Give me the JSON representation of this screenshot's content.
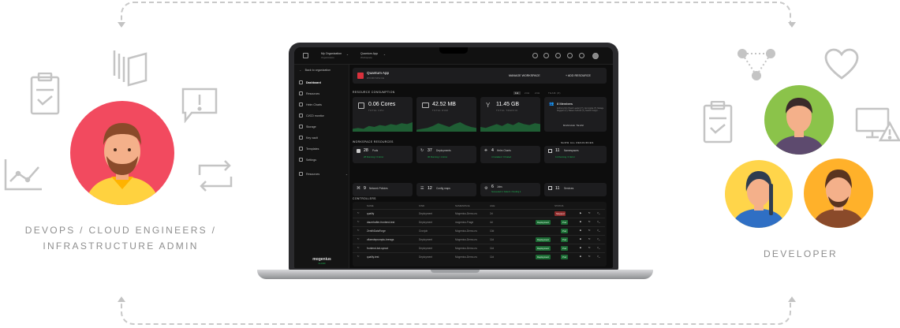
{
  "roles": {
    "ops_line1": "DEVOPS / CLOUD ENGINEERS /",
    "ops_line2": "INFRASTRUCTURE ADMIN",
    "dev": "DEVELOPER"
  },
  "colors": {
    "icon_gray": "#c4c4c4",
    "ops_avatar_bg": "#f24a5f",
    "dev_avatar_bg_1": "#8bc34a",
    "dev_avatar_bg_2": "#ffd54a",
    "dev_avatar_bg_3": "#ffb12a",
    "accent_green": "#1db954",
    "brand_red": "#d9313c"
  },
  "side_icons_left": [
    "clipboard-check-icon",
    "stacked-cards-icon",
    "alert-message-icon",
    "line-chart-icon",
    "sync-arrows-icon"
  ],
  "side_icons_right": [
    "network-nodes-icon",
    "heart-icon",
    "clipboard-check-icon",
    "monitor-warning-icon"
  ],
  "app": {
    "org_label": "My Organization",
    "org_sub": "Organization",
    "project_label": "Quantum App",
    "project_sub": "Workspace",
    "back_link": "Back to organization",
    "sidebar": [
      {
        "label": "Dashboard",
        "active": true
      },
      {
        "label": "Resources"
      },
      {
        "label": "Helm Charts"
      },
      {
        "label": "CI/CD monitor"
      },
      {
        "label": "Storage"
      },
      {
        "label": "Key vault"
      },
      {
        "label": "Templates"
      },
      {
        "label": "Settings"
      },
      {
        "label": "Resources"
      }
    ],
    "brand": "mogenius",
    "brand_sub": "CLOUD",
    "workspace_title": "Quantum App",
    "workspace_sub": "WORKSPACE",
    "manage_btn": "MANAGE WORKSPACE",
    "add_btn": "+ ADD RESOURCE",
    "consumption_title": "RESOURCE CONSUMPTION",
    "time_tabs": [
      "1H",
      "24H",
      "24H",
      "TEAM (8)"
    ],
    "metrics": [
      {
        "value": "0.06 Cores",
        "label": "TOTAL CPU",
        "series": [
          3,
          4,
          3,
          6,
          5,
          7,
          6,
          8,
          7,
          9,
          8,
          10
        ]
      },
      {
        "value": "42.52 MB",
        "label": "TOTAL RAM",
        "series": [
          2,
          3,
          4,
          6,
          9,
          7,
          5,
          8,
          10,
          7,
          5,
          4
        ]
      },
      {
        "value": "11.45 GB",
        "label": "TOTAL TRAFFIC",
        "series": [
          5,
          4,
          6,
          8,
          6,
          9,
          7,
          10,
          8,
          7,
          9,
          8
        ]
      }
    ],
    "team": {
      "title": "8 Members",
      "text": "Anthony Kim (Team Leader) (T), Jan Lippke (T), Melage Ruggiero (T), Maisen Schmitt (T), Nesbitt Yeeger ...",
      "button": "MANAGE TEAM"
    },
    "workspace_resources_title": "WORKSPACE RESOURCES",
    "show_all": "SHOW ALL RESOURCES",
    "resource_cards": [
      {
        "count": "28",
        "name": "Pods",
        "detail": "28 Running / 0 Error"
      },
      {
        "count": "37",
        "name": "Deployments",
        "detail": "36 Running / 1 Error"
      },
      {
        "count": "4",
        "name": "Helm Charts",
        "detail": "4 Installed / 0 Failed"
      },
      {
        "count": "11",
        "name": "Namespaces",
        "detail": "11 Running / 0 Error"
      }
    ],
    "resource_cards_row2": [
      {
        "count": "9",
        "name": "Network Policies",
        "detail": ""
      },
      {
        "count": "12",
        "name": "Config maps",
        "detail": ""
      },
      {
        "count": "6",
        "name": "Jobs",
        "detail": "Succeeded 3 / Failed 1 / Pending 2"
      },
      {
        "count": "11",
        "name": "Services",
        "detail": ""
      }
    ],
    "controllers_title": "CONTROLLERS",
    "controllers_cols": [
      "NAME",
      "KIND",
      "NAMESPACE",
      "AGE",
      "STATUS"
    ],
    "controllers_rows": [
      {
        "name": "quality",
        "kind": "Deployment",
        "ns": "Mogenius-Demo-ns",
        "age": "2d",
        "status": [
          "Stopped"
        ]
      },
      {
        "name": "dauerhafter-frontend-test",
        "kind": "Deployment",
        "ns": "mogenius-Frage",
        "age": "4d",
        "status": [
          "Deployment",
          "Pod"
        ]
      },
      {
        "name": "ZenithDataForge",
        "kind": "Cronjob",
        "ns": "Mogenius-Demo-ns",
        "age": "10d",
        "status": [
          "Pod"
        ]
      },
      {
        "name": "cflaredepromptu-brewgs",
        "kind": "Deployment",
        "ns": "Mogenius-Demo-ns",
        "age": "11d",
        "status": [
          "Deployment",
          "Pod"
        ]
      },
      {
        "name": "frontend-bot-sprout",
        "kind": "Deployment",
        "ns": "Mogenius-Demo-ns",
        "age": "11d",
        "status": [
          "Deployment",
          "Pod"
        ]
      },
      {
        "name": "quality-test",
        "kind": "Deployment",
        "ns": "Mogenius-Demo-ns",
        "age": "11d",
        "status": [
          "Deployment",
          "Pod"
        ]
      }
    ]
  }
}
